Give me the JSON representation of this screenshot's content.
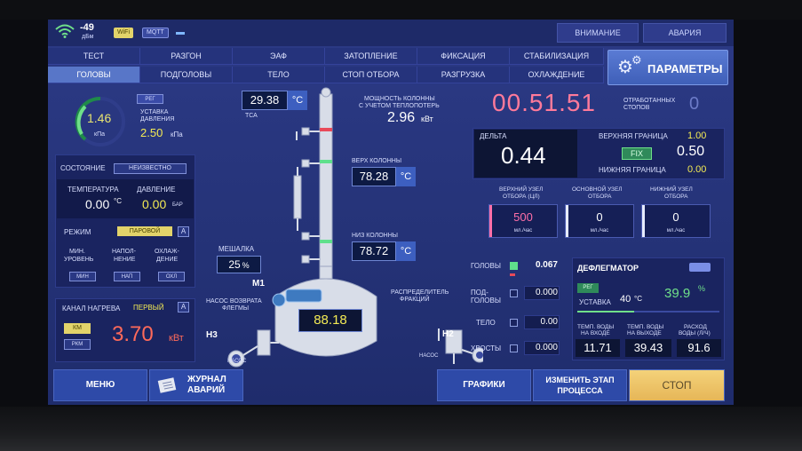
{
  "status": {
    "signal_value": "-49",
    "signal_unit": "дБм",
    "wifi_chip": "WiFi",
    "mqtt_chip": "MQTT",
    "warning": "ВНИМАНИЕ",
    "alarm": "АВАРИЯ"
  },
  "tabs_row1": [
    "ТЕСТ",
    "РАЗГОН",
    "ЭАФ",
    "ЗАТОПЛЕНИЕ",
    "ФИКСАЦИЯ",
    "СТАБИЛИЗАЦИЯ"
  ],
  "tabs_row2": [
    "ГОЛОВЫ",
    "ПОДГОЛОВЫ",
    "ТЕЛО",
    "СТОП ОТБОРА",
    "РАЗГРУЗКА",
    "ОХЛАЖДЕНИЕ"
  ],
  "active_tab": "ГОЛОВЫ",
  "params_button": "ПАРАМЕТРЫ",
  "pressure": {
    "value": "1.46",
    "unit": "кПа",
    "reg": "РЕГ",
    "setpoint_label_1": "УСТАВКА",
    "setpoint_label_2": "ДАВЛЕНИЯ",
    "setpoint_value": "2.50",
    "setpoint_unit": "кПа"
  },
  "state": {
    "label": "СОСТОЯНИЕ",
    "value": "НЕИЗВЕСТНО",
    "temp_label": "ТЕМПЕРАТУРА",
    "temp_value": "0.00",
    "temp_unit": "°C",
    "press_label": "ДАВЛЕНИЕ",
    "press_value": "0.00",
    "press_unit": "БАР",
    "mode_label": "РЕЖИМ",
    "mode_value": "ПАРОВОЙ",
    "mode_a": "A",
    "col1_l1": "МИН.",
    "col1_l2": "УРОВЕНЬ",
    "col1_btn": "МИН",
    "col2_l1": "НАПОЛ-",
    "col2_l2": "НЕНИЕ",
    "col2_btn": "НАП",
    "col3_l1": "ОХЛАЖ-",
    "col3_l2": "ДЕНИЕ",
    "col3_btn": "ОХЛ"
  },
  "heat": {
    "label": "КАНАЛ НАГРЕВА",
    "channel": "ПЕРВЫЙ",
    "a": "A",
    "km": "КМ",
    "rkm": "РКМ",
    "value": "3.70",
    "unit": "кВт"
  },
  "column": {
    "tsa_value": "29.38",
    "tsa_unit": "°C",
    "tsa_label": "ТСА",
    "power_l1": "МОЩНОСТЬ КОЛОННЫ",
    "power_l2": "С УЧЕТОМ ТЕПЛОПОТЕРЬ",
    "power_value": "2.96",
    "power_unit": "кВт",
    "top_label": "ВЕРХ КОЛОННЫ",
    "top_value": "78.28",
    "top_unit": "°C",
    "bottom_label": "НИЗ КОЛОННЫ",
    "bottom_value": "78.72",
    "bottom_unit": "°C",
    "mixer_label": "МЕШАЛКА",
    "mixer_value": "25",
    "mixer_unit": "%",
    "m1": "М1",
    "cube_value": "88.18",
    "pump_l1": "НАСОС ВОЗВРАТА",
    "pump_l2": "ФЛЕГМЫ",
    "h3": "Н3",
    "pump_caption": "НАСОС",
    "distr_l1": "РАСПРЕДЕЛИТЕЛЬ",
    "distr_l2": "ФРАКЦИЙ",
    "h2": "Н2",
    "pump2_caption": "НАСОС"
  },
  "timer": {
    "value": "00.51.51",
    "stops_l1": "ОТРАБОТАННЫХ",
    "stops_l2": "СТОПОВ",
    "stops_value": "0"
  },
  "delta": {
    "label": "ДЕЛЬТА",
    "value": "0.44",
    "upper_label": "ВЕРХНЯЯ ГРАНИЦА",
    "upper_value": "1.00",
    "fix": "FIX",
    "current_value": "0.50",
    "lower_label": "НИЖНЯЯ ГРАНИЦА",
    "lower_value": "0.00"
  },
  "nodes": [
    {
      "l1": "ВЕРХНИЙ УЗЕЛ",
      "l2": "ОТБОРА (ЦЛ)",
      "value": "500",
      "unit": "мл./час",
      "color": "#ff6fa8"
    },
    {
      "l1": "ОСНОВНОЙ УЗЕЛ",
      "l2": "ОТБОРА",
      "value": "0",
      "unit": "мл./час",
      "color": "#ffffff"
    },
    {
      "l1": "НИЖНИЙ УЗЕЛ",
      "l2": "ОТБОРА",
      "value": "0",
      "unit": "мл./час",
      "color": "#ffffff"
    }
  ],
  "products": [
    {
      "l1": "ГОЛОВЫ",
      "l2": "",
      "value": "0.067",
      "on": true
    },
    {
      "l1": "ПОД-",
      "l2": "ГОЛОВЫ",
      "value": "0.000",
      "on": false
    },
    {
      "l1": "ТЕЛО",
      "l2": "",
      "value": "0.00",
      "on": false
    },
    {
      "l1": "ХВОСТЫ",
      "l2": "",
      "value": "0.000",
      "on": false
    }
  ],
  "deflegmator": {
    "title": "ДЕФЛЕГМАТОР",
    "reg": "РЕГ",
    "setpoint_label": "УСТАВКА",
    "setpoint_value": "40",
    "setpoint_unit": "°C",
    "percent_value": "39.9",
    "percent_unit": "%",
    "level": 0.399,
    "in_l1": "ТЕМП. ВОДЫ",
    "in_l2": "НА ВХОДЕ",
    "in_value": "11.71",
    "out_l1": "ТЕМП. ВОДЫ",
    "out_l2": "НА ВЫХОДЕ",
    "out_value": "39.43",
    "flow_l1": "РАСХОД",
    "flow_l2": "ВОДЫ (Л/Ч)",
    "flow_value": "91.6"
  },
  "footer": {
    "menu": "МЕНЮ",
    "journal_l1": "ЖУРНАЛ",
    "journal_l2": "АВАРИЙ",
    "graphs": "ГРАФИКИ",
    "change_l1": "ИЗМЕНИТЬ ЭТАП",
    "change_l2": "ПРОЦЕССА",
    "stop": "СТОП"
  }
}
